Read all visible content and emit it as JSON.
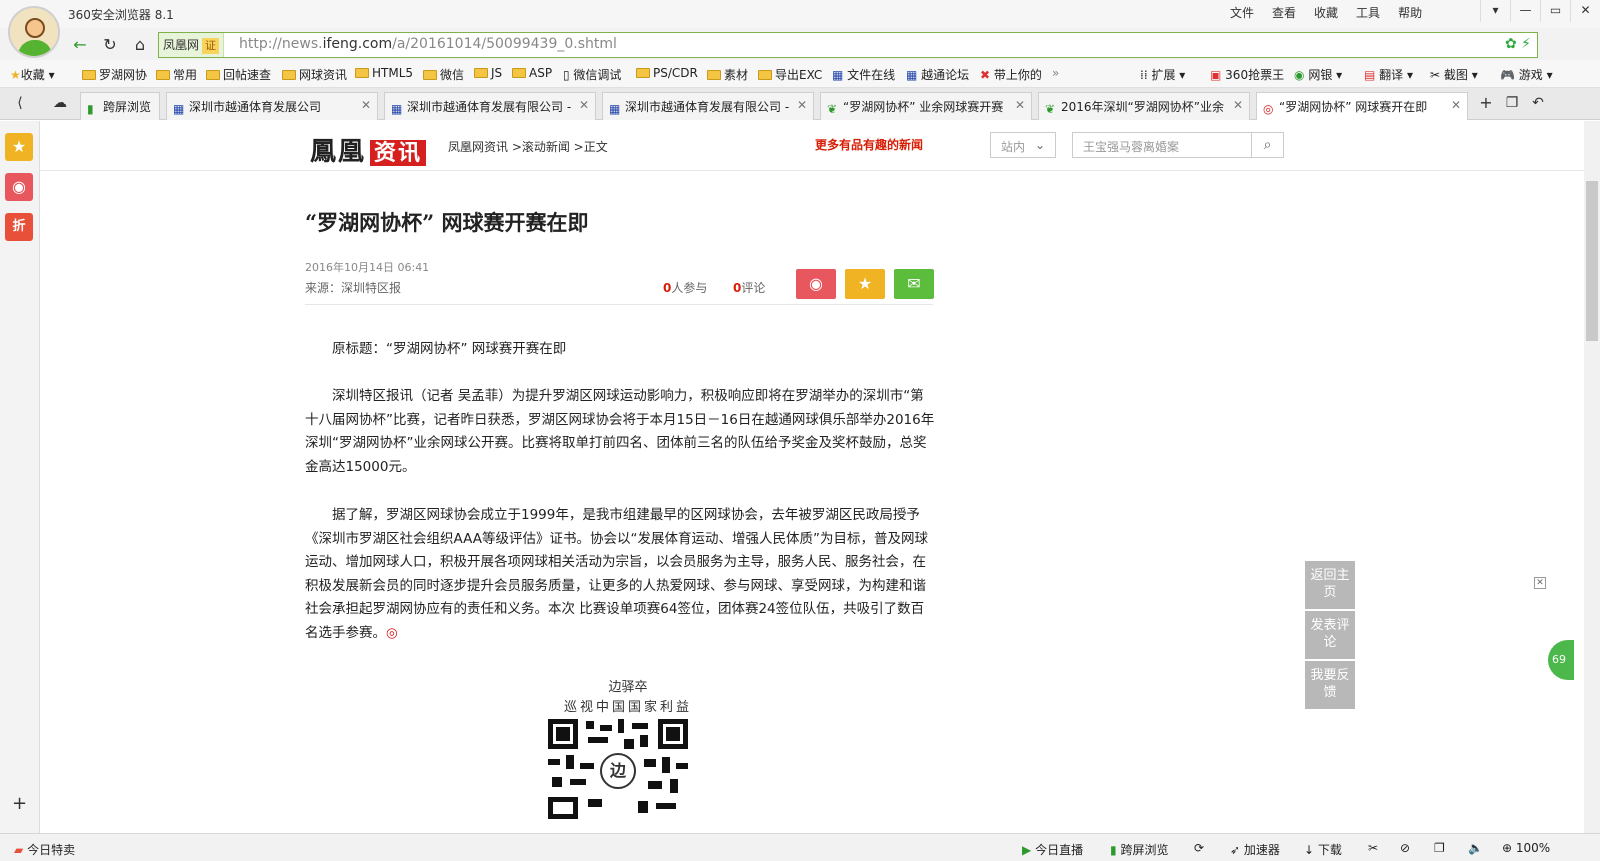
{
  "browser": {
    "app_title": "360安全浏览器 8.1",
    "menu": [
      "文件",
      "查看",
      "收藏",
      "工具",
      "帮助"
    ],
    "address": {
      "site_label": "凤凰网",
      "cert_label": "证",
      "url_prefix": "http://news.",
      "url_domain": "ifeng.com",
      "url_path": "/a/20161014/50099439_0.shtml"
    },
    "bookmarks": [
      "收藏",
      "罗湖网协",
      "常用",
      "回帖速查",
      "网球资讯",
      "HTML5",
      "微信",
      "JS",
      "ASP",
      "微信调试",
      "PS/CDR",
      "素材",
      "导出EXC",
      "文件在线",
      "越通论坛",
      "带上你的"
    ],
    "bookmark_tools": [
      "扩展",
      "360抢票王",
      "网银",
      "翻译",
      "截图",
      "游戏"
    ],
    "tabs": [
      {
        "label": "跨屏浏览"
      },
      {
        "label": "深圳市越通体育发展公司"
      },
      {
        "label": "深圳市越通体育发展有限公司 -"
      },
      {
        "label": "深圳市越通体育发展有限公司 -"
      },
      {
        "label": "“罗湖网协杯” 业余网球赛开赛"
      },
      {
        "label": "2016年深圳“罗湖网协杯”业余"
      },
      {
        "label": "“罗湖网协杯” 网球赛开在即"
      }
    ],
    "statusbar": {
      "left": "今日特卖",
      "items": [
        "今日直播",
        "跨屏浏览",
        "加速器",
        "下载"
      ],
      "zoom": "100%"
    }
  },
  "page": {
    "logo_main": "鳳凰",
    "logo_red": "资讯",
    "crumb": "凤凰网资讯 >滚动新闻 >正文",
    "slogan": "更多有品有趣的新闻",
    "select_label": "站内",
    "search_placeholder": "王宝强马蓉离婚案",
    "title": "“罗湖网协杯” 网球赛开赛在即",
    "date": "2016年10月14日 06:41",
    "source": "来源：深圳特区报",
    "participants_count": "0",
    "participants_label": "人参与",
    "comments_count": "0",
    "comments_label": "评论",
    "paragraphs": [
      "原标题：“罗湖网协杯” 网球赛开赛在即",
      "深圳特区报讯（记者 吴孟菲）为提升罗湖区网球运动影响力，积极响应即将在罗湖举办的深圳市“第十八届网协杯”比赛，记者昨日获悉，罗湖区网球协会将于本月15日－16日在越通网球俱乐部举办2016年深圳“罗湖网协杯”业余网球公开赛。比赛将取单打前四名、团体前三名的队伍给予奖金及奖杯鼓励，总奖金高达15000元。",
      "据了解，罗湖区网球协会成立于1999年，是我市组建最早的区网球协会，去年被罗湖区民政局授予《深圳市罗湖区社会组织AAA等级评估》证书。协会以“发展体育运动、增强人民体质”为目标，普及网球运动、增加网球人口，积极开展各项网球相关活动为宗旨，以会员服务为主导，服务人民、服务社会，在积极发展新会员的同时逐步提升会员服务质量，让更多的人热爱网球、参与网球、享受网球，为构建和谐社会承担起罗湖网协应有的责任和义务。本次 比赛设单项赛64签位，团体赛24签位队伍，共吸引了数百名选手参赛。"
    ],
    "qr_caption_1": "边驿卒",
    "qr_caption_2": "巡视中国国家利益",
    "qr_center": "边",
    "float_buttons": [
      "返回主页",
      "发表评论",
      "我要反馈"
    ],
    "side_bubble": "69"
  },
  "colors": {
    "accent_green": "#55b331",
    "brand_red": "#d61f1f",
    "weibo": "#e8565e",
    "star": "#f0b323",
    "wechat": "#5cbc3c"
  }
}
